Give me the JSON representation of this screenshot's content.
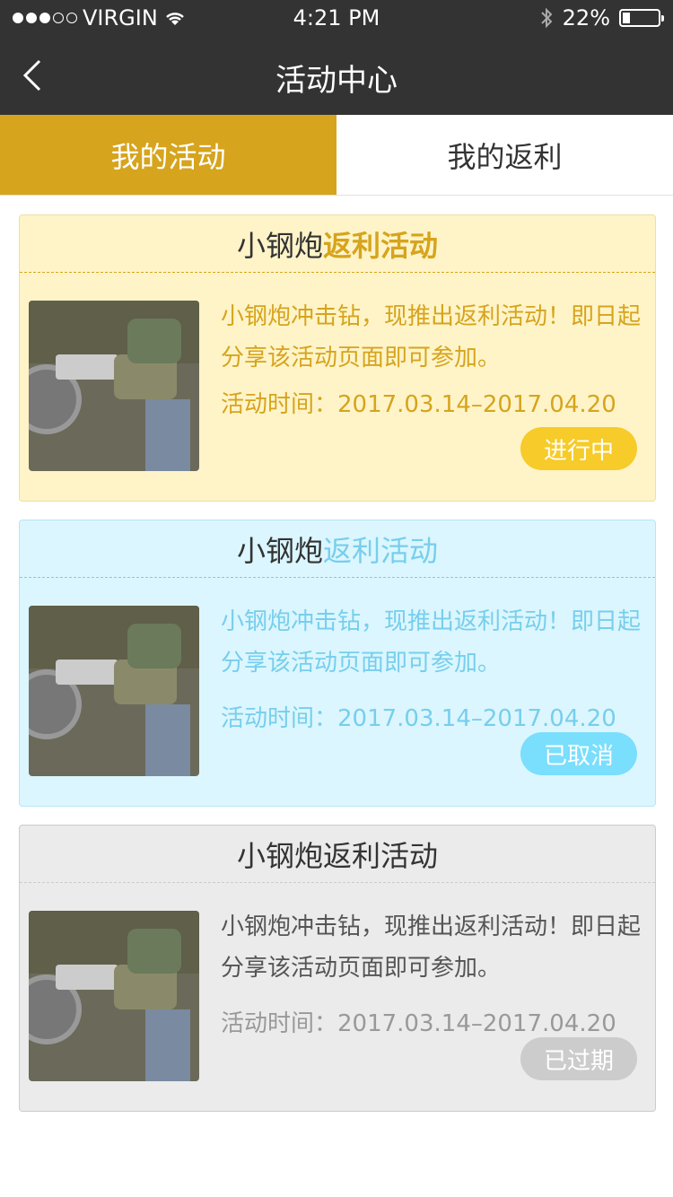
{
  "status_bar": {
    "carrier": "VIRGIN",
    "time": "4:21 PM",
    "battery": "22%"
  },
  "nav": {
    "title": "活动中心"
  },
  "tabs": [
    {
      "label": "我的活动"
    },
    {
      "label": "我的返利"
    }
  ],
  "cards": [
    {
      "title_prefix": "小钢炮",
      "title_highlight": "返利活动",
      "description": "小钢炮冲击钻，现推出返利活动！即日起分享该活动页面即可参加。",
      "time": "活动时间：2017.03.14–2017.04.20",
      "status": "进行中"
    },
    {
      "title_prefix": "小钢炮",
      "title_highlight": "返利活动",
      "description": "小钢炮冲击钻，现推出返利活动！即日起分享该活动页面即可参加。",
      "time": "活动时间：2017.03.14–2017.04.20",
      "status": "已取消"
    },
    {
      "title_prefix": "小钢炮",
      "title_highlight": "返利活动",
      "description": "小钢炮冲击钻，现推出返利活动！即日起分享该活动页面即可参加。",
      "time": "活动时间：2017.03.14–2017.04.20",
      "status": "已过期"
    }
  ],
  "colors": {
    "header": "#333333",
    "active_tab": "#d6a41d",
    "ongoing": "#F6CB2A",
    "cancelled": "#7ADEFD",
    "expired": "#CCCCCC"
  }
}
